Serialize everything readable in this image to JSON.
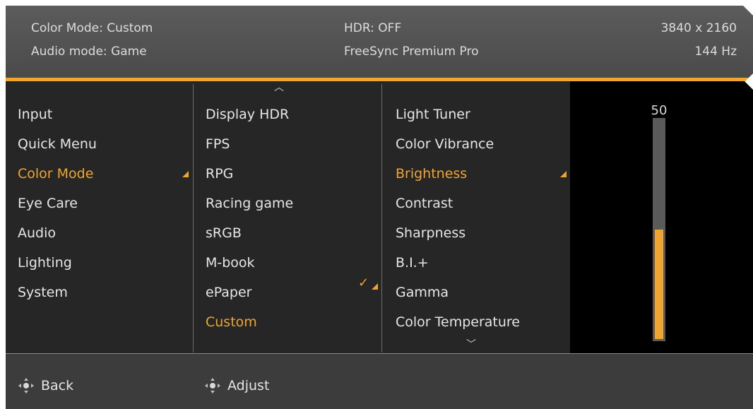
{
  "header": {
    "color_mode": "Color Mode: Custom",
    "audio_mode": "Audio mode: Game",
    "hdr": "HDR: OFF",
    "freesync": "FreeSync Premium Pro",
    "resolution": "3840 x 2160",
    "refresh": "144 Hz"
  },
  "main_menu": {
    "items": [
      "Input",
      "Quick Menu",
      "Color Mode",
      "Eye Care",
      "Audio",
      "Lighting",
      "System"
    ],
    "active_index": 2
  },
  "color_modes": {
    "items": [
      "Display HDR",
      "FPS",
      "RPG",
      "Racing game",
      "sRGB",
      "M-book",
      "ePaper",
      "Custom"
    ],
    "active_index": 7,
    "checkmark_glyph": "✓"
  },
  "settings": {
    "items": [
      "Light Tuner",
      "Color Vibrance",
      "Brightness",
      "Contrast",
      "Sharpness",
      "B.I.+",
      "Gamma",
      "Color Temperature"
    ],
    "active_index": 2,
    "scroll_up_glyph": "︿",
    "scroll_down_glyph": "﹀"
  },
  "slider": {
    "label": "50",
    "level_fraction": 0.5
  },
  "footer": {
    "back_label": "Back",
    "adjust_label": "Adjust"
  },
  "colors": {
    "accent": "#f0a530",
    "header_bg": "#555555",
    "panel_bg": "#262626",
    "footer_bg": "#3c3c3c"
  },
  "icons": [
    "joystick-icon",
    "chevron-up-icon",
    "chevron-down-icon",
    "checkmark-icon",
    "submenu-triangle-icon"
  ]
}
